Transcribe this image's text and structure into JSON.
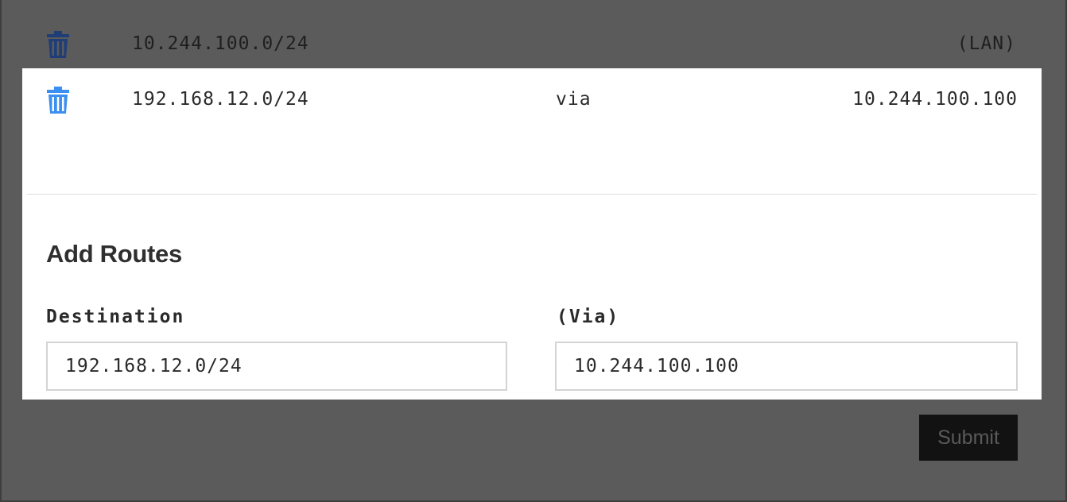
{
  "routes": [
    {
      "destination": "10.244.100.0/24",
      "via_label": "",
      "gateway": "(LAN)"
    },
    {
      "destination": "192.168.12.0/24",
      "via_label": "via",
      "gateway": "10.244.100.100"
    }
  ],
  "add_routes": {
    "title": "Add Routes",
    "destination_label": "Destination",
    "destination_value": "192.168.12.0/24",
    "via_field_label": "(Via)",
    "via_value": "10.244.100.100",
    "submit_label": "Submit"
  },
  "icons": {
    "delete": "trash-icon"
  },
  "colors": {
    "background": "#5b5b5b",
    "panel": "#ffffff",
    "trash_dim": "#1f3e78",
    "trash_active": "#3b8ff0",
    "submit_bg": "#121212",
    "submit_text": "#5a5a5a"
  }
}
